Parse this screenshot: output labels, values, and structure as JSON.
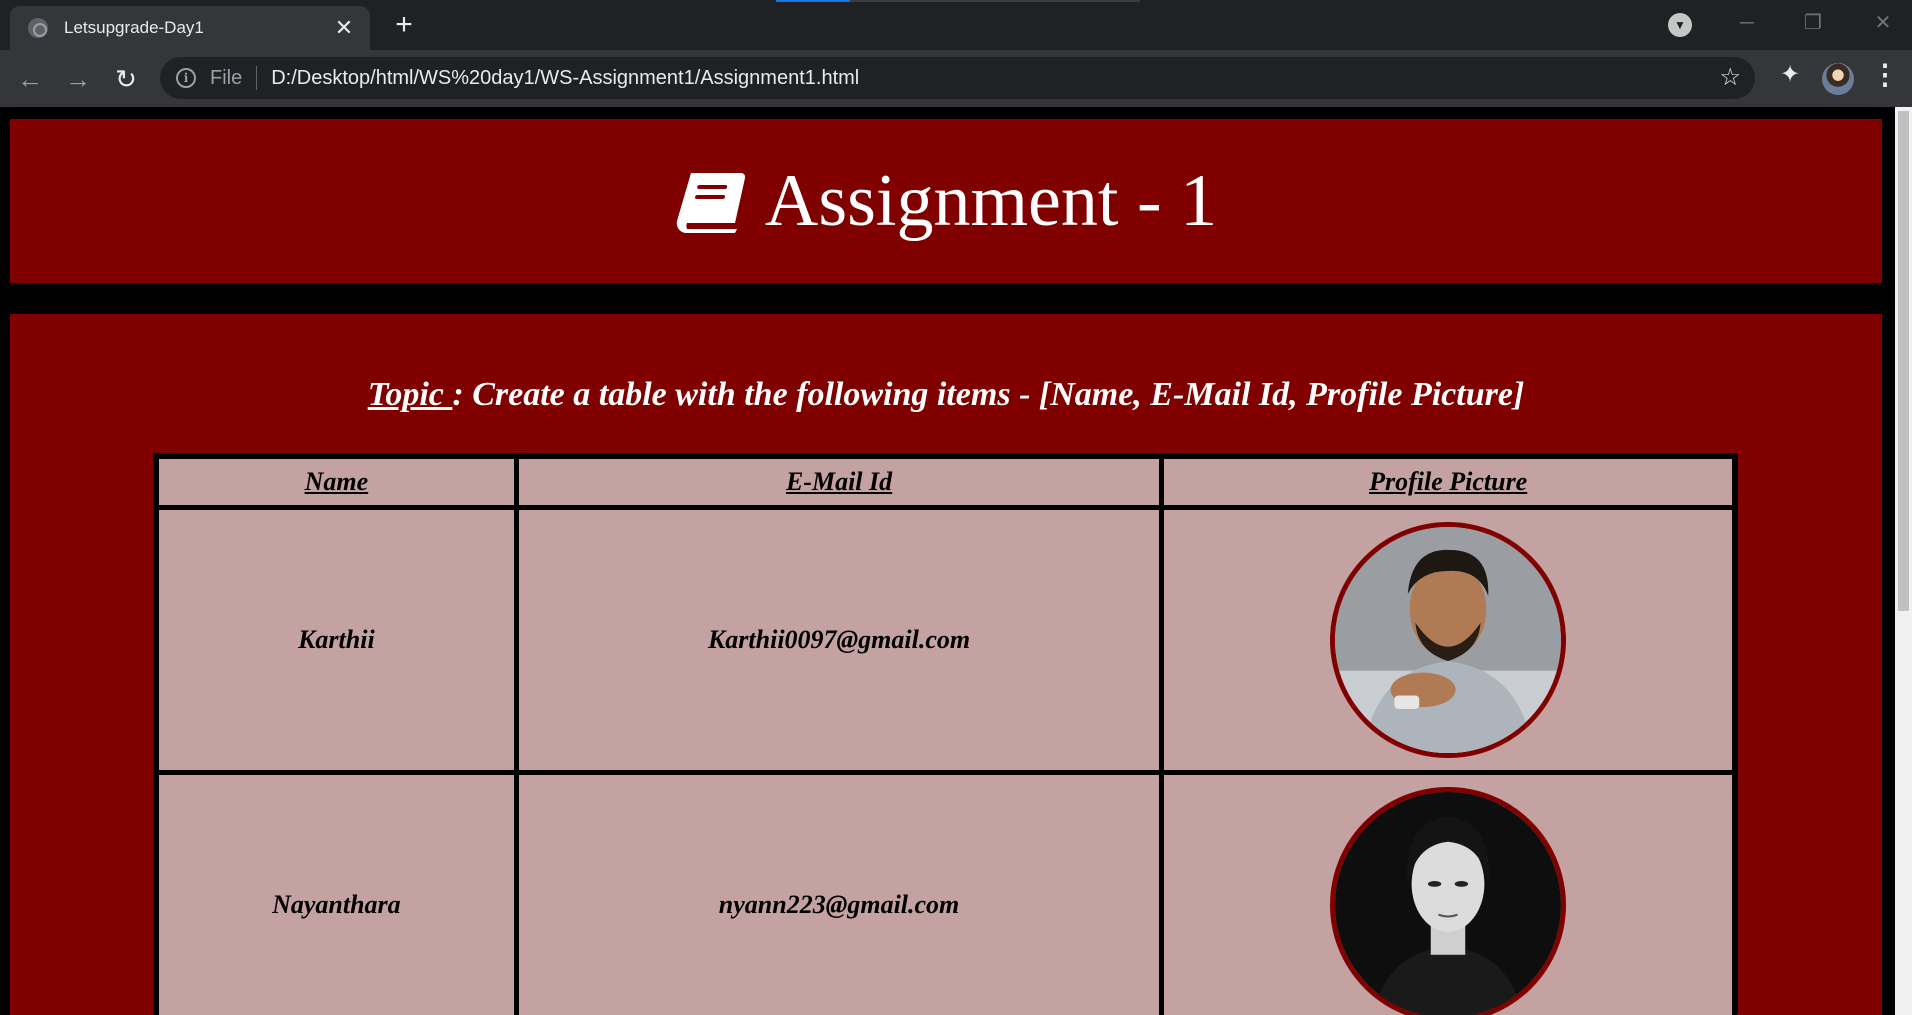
{
  "browser": {
    "tab_title": "Letsupgrade-Day1",
    "tab_close": "✕",
    "new_tab": "+",
    "scheme_label": "File",
    "url": "D:/Desktop/html/WS%20day1/WS-Assignment1/Assignment1.html",
    "window_controls": {
      "minimize": "─",
      "restore": "❐",
      "close": "✕"
    },
    "nav": {
      "back": "←",
      "forward": "→",
      "reload": "↻"
    },
    "icons": {
      "star": "☆",
      "extensions": "✦",
      "menu": "⋮",
      "info": "i",
      "tab_search": "▼"
    }
  },
  "page": {
    "title": "Assignment - 1",
    "topic_label": "Topic ",
    "topic_text": ": Create a table with the following items - [Name, E-Mail Id, Profile Picture]",
    "table": {
      "headers": [
        "Name",
        "E-Mail Id",
        "Profile Picture"
      ],
      "rows": [
        {
          "name": "Karthii",
          "email": "Karthii0097@gmail.com",
          "picture": "profile-photo-karthii"
        },
        {
          "name": "Nayanthara",
          "email": "nyann223@gmail.com",
          "picture": "profile-photo-nayanthara"
        }
      ]
    }
  },
  "colors": {
    "maroon": "#800000",
    "cell_bg": "#c4a2a2",
    "chrome_dark": "#202124",
    "chrome_mid": "#35363a"
  }
}
